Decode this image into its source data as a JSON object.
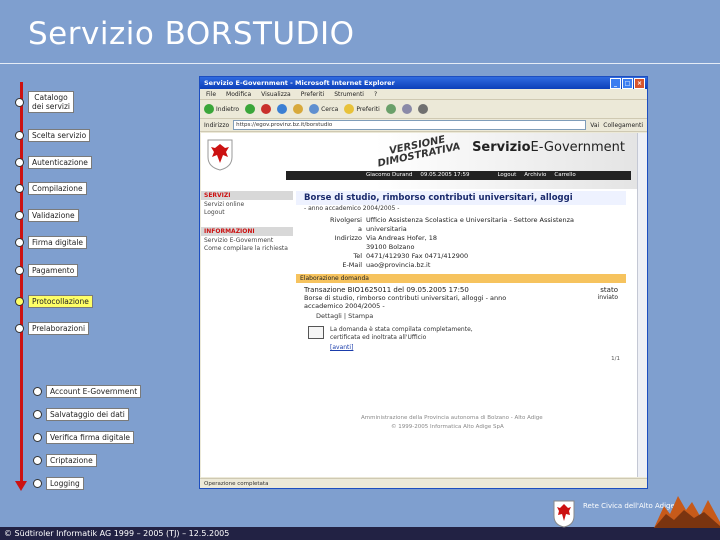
{
  "slide": {
    "title": "Servizio BORSTUDIO"
  },
  "steps": [
    {
      "label": "Catalogo dei servizi",
      "active": false
    },
    {
      "label": "Scelta servizio",
      "active": false
    },
    {
      "label": "Autenticazione",
      "active": false
    },
    {
      "label": "Compilazione",
      "active": false
    },
    {
      "label": "Validazione",
      "active": false
    },
    {
      "label": "Firma digitale",
      "active": false
    },
    {
      "label": "Pagamento",
      "active": false
    },
    {
      "label": "Protocollazione",
      "active": true
    },
    {
      "label": "Prelaborazioni",
      "active": false
    }
  ],
  "substeps": [
    {
      "label": "Account E-Government"
    },
    {
      "label": "Salvataggio dei dati"
    },
    {
      "label": "Verifica firma digitale"
    },
    {
      "label": "Criptazione"
    },
    {
      "label": "Logging"
    }
  ],
  "browser": {
    "window_title": "Servizio E-Government - Microsoft Internet Explorer",
    "menu": [
      "File",
      "Modifica",
      "Visualizza",
      "Preferiti",
      "Strumenti",
      "?"
    ],
    "toolbar": {
      "back": "Indietro",
      "search": "Cerca",
      "favorites": "Preferiti"
    },
    "address_label": "Indirizzo",
    "address_value": "https://egov.provinz.bz.it/borstudio",
    "go_label": "Vai",
    "links_label": "Collegamenti",
    "status": "Operazione completata"
  },
  "page": {
    "demo_stamp_line1": "VERSIONE",
    "demo_stamp_line2": "DIMOSTRATIVA",
    "service_logo_bold": "Servizio",
    "service_logo_rest": "E-Government",
    "user": "Giacomo Durand",
    "date": "09.05.2005 17:59",
    "user_links": [
      "Logout",
      "Archivio",
      "Carrello"
    ],
    "sidebar": {
      "section1": "SERVIZI",
      "section1_items": [
        "Servizi online",
        "Logout"
      ],
      "section2": "INFORMAZIONI",
      "section2_items": [
        "Servizio E-Government",
        "Come compilare la richiesta"
      ]
    },
    "heading": "Borse di studio, rimborso contributi universitari, alloggi",
    "year": "- anno accademico 2004/2005 -",
    "office_info": [
      {
        "label": "Rivolgersi a",
        "value": "Ufficio Assistenza Scolastica e Universitaria - Settore Assistenza universitaria"
      },
      {
        "label": "Indirizzo",
        "value": "Via Andreas Hofer, 18"
      },
      {
        "label": "",
        "value": "39100 Bolzano"
      },
      {
        "label": "Tel",
        "value": "0471/412930  Fax 0471/412900"
      },
      {
        "label": "E-Mail",
        "value": "uao@provincia.bz.it"
      }
    ],
    "section_bar": "Elaborazione domanda",
    "transaction": "Transazione BIO1625011 del 09.05.2005 17:50",
    "status_label": "stato",
    "status_value": "inviato",
    "trans_desc": "Borse di studio, rimborso contributi universitari, alloggi - anno accademico 2004/2005 -",
    "links_row": "Dettagli  |  Stampa",
    "mail_message": "La domanda è stata compilata completamente, certificata ed inoltrata all'Ufficio",
    "mail_link": "[avanti]",
    "page_num": "1/1",
    "footer_line1": "Amministrazione della Provincia autonoma di Bolzano - Alto Adige",
    "footer_line2": "© 1999-2005 Informatica Alto Adige SpA"
  },
  "footer": {
    "copyright": "© Südtiroler Informatik AG 1999 – 2005  (TJ) – 12.5.2005",
    "brand_line1": "Rete Civica dell'Alto Adige"
  },
  "colors": {
    "background": "#7f9fcf",
    "arrow": "#cc1111",
    "active_step": "#ffff66"
  }
}
